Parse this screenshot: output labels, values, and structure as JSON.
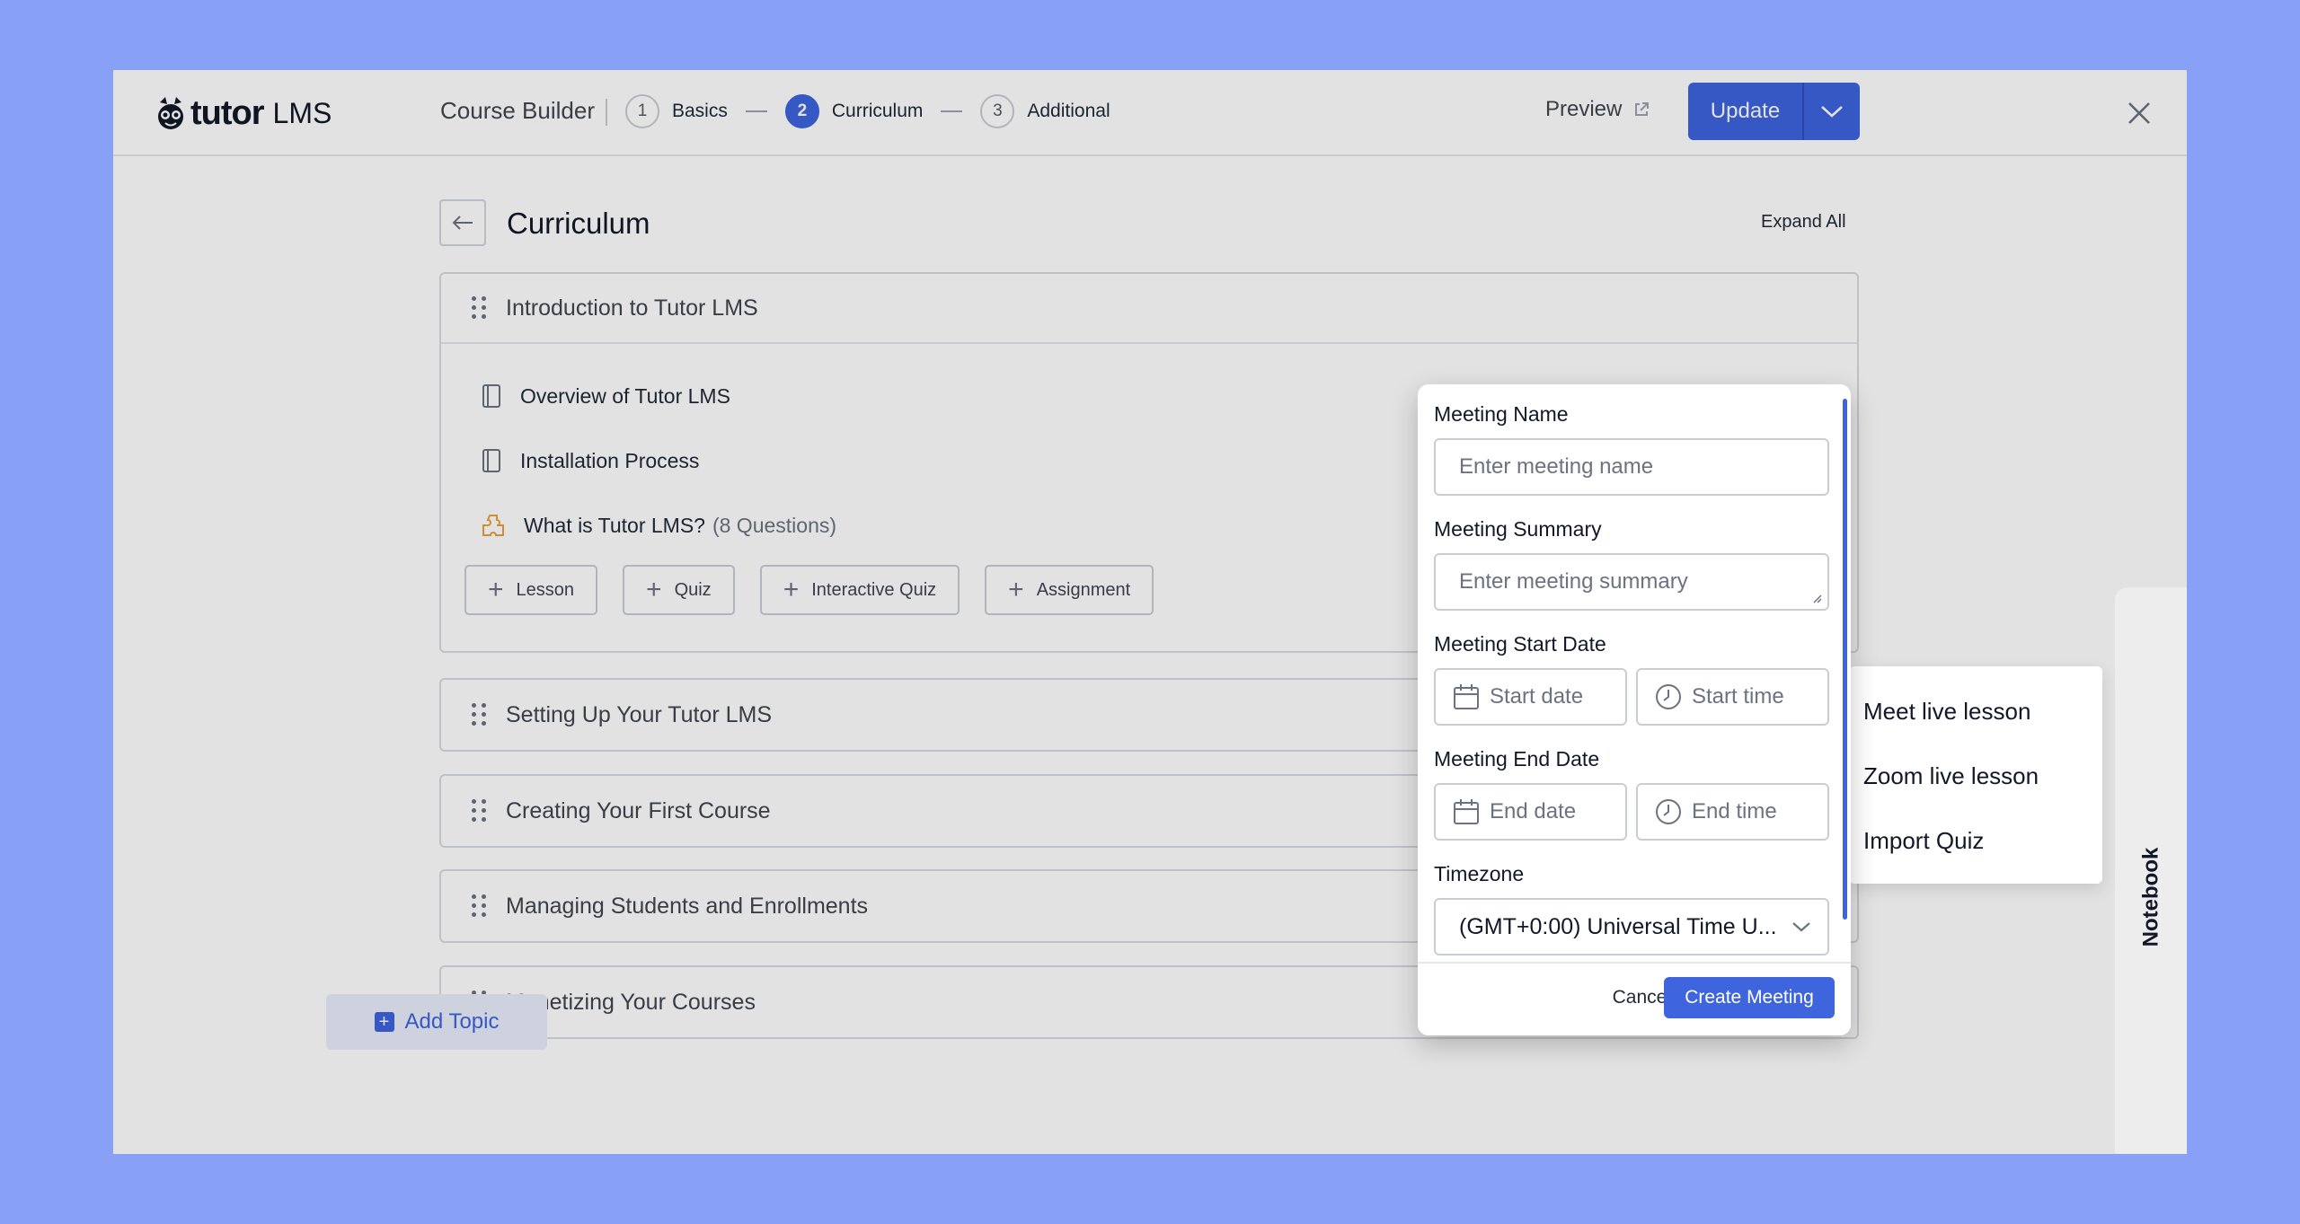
{
  "header": {
    "brand": "tutor",
    "brand_suffix": "LMS",
    "course_builder": "Course Builder",
    "steps": [
      {
        "num": "1",
        "label": "Basics"
      },
      {
        "num": "2",
        "label": "Curriculum"
      },
      {
        "num": "3",
        "label": "Additional"
      }
    ],
    "preview_label": "Preview",
    "update_label": "Update"
  },
  "page": {
    "title": "Curriculum",
    "expand_all": "Expand All"
  },
  "topics": [
    {
      "title": "Introduction to Tutor LMS"
    },
    {
      "title": "Setting Up Your Tutor LMS"
    },
    {
      "title": "Creating Your First Course"
    },
    {
      "title": "Managing Students and Enrollments"
    },
    {
      "title": "Monetizing Your Courses"
    }
  ],
  "open_topic_items": [
    {
      "icon": "lesson-icon",
      "title": "Overview of Tutor LMS",
      "extra": ""
    },
    {
      "icon": "lesson-icon",
      "title": "Installation Process",
      "extra": ""
    },
    {
      "icon": "quiz-icon",
      "title": "What is Tutor LMS?",
      "extra": "(8 Questions)"
    }
  ],
  "add_buttons": {
    "lesson": "Lesson",
    "quiz": "Quiz",
    "interactive_quiz": "Interactive Quiz",
    "assignment": "Assignment"
  },
  "add_topic": "Add Topic",
  "modal": {
    "meeting_name_label": "Meeting Name",
    "meeting_name_placeholder": "Enter meeting name",
    "meeting_summary_label": "Meeting Summary",
    "meeting_summary_placeholder": "Enter meeting summary",
    "start_date_label": "Meeting Start Date",
    "start_date_placeholder": "Start date",
    "start_time_placeholder": "Start time",
    "end_date_label": "Meeting End Date",
    "end_date_placeholder": "End date",
    "end_time_placeholder": "End time",
    "timezone_label": "Timezone",
    "timezone_value": "(GMT+0:00) Universal Time U...",
    "cancel": "Cancel",
    "create": "Create Meeting"
  },
  "menu": {
    "items": [
      "Meet live lesson",
      "Zoom live lesson",
      "Import Quiz"
    ]
  },
  "notebook": "Notebook",
  "colors": {
    "accent": "#3e64de",
    "backdrop": "#88a0f6",
    "quiz_icon": "#e9a23b"
  }
}
